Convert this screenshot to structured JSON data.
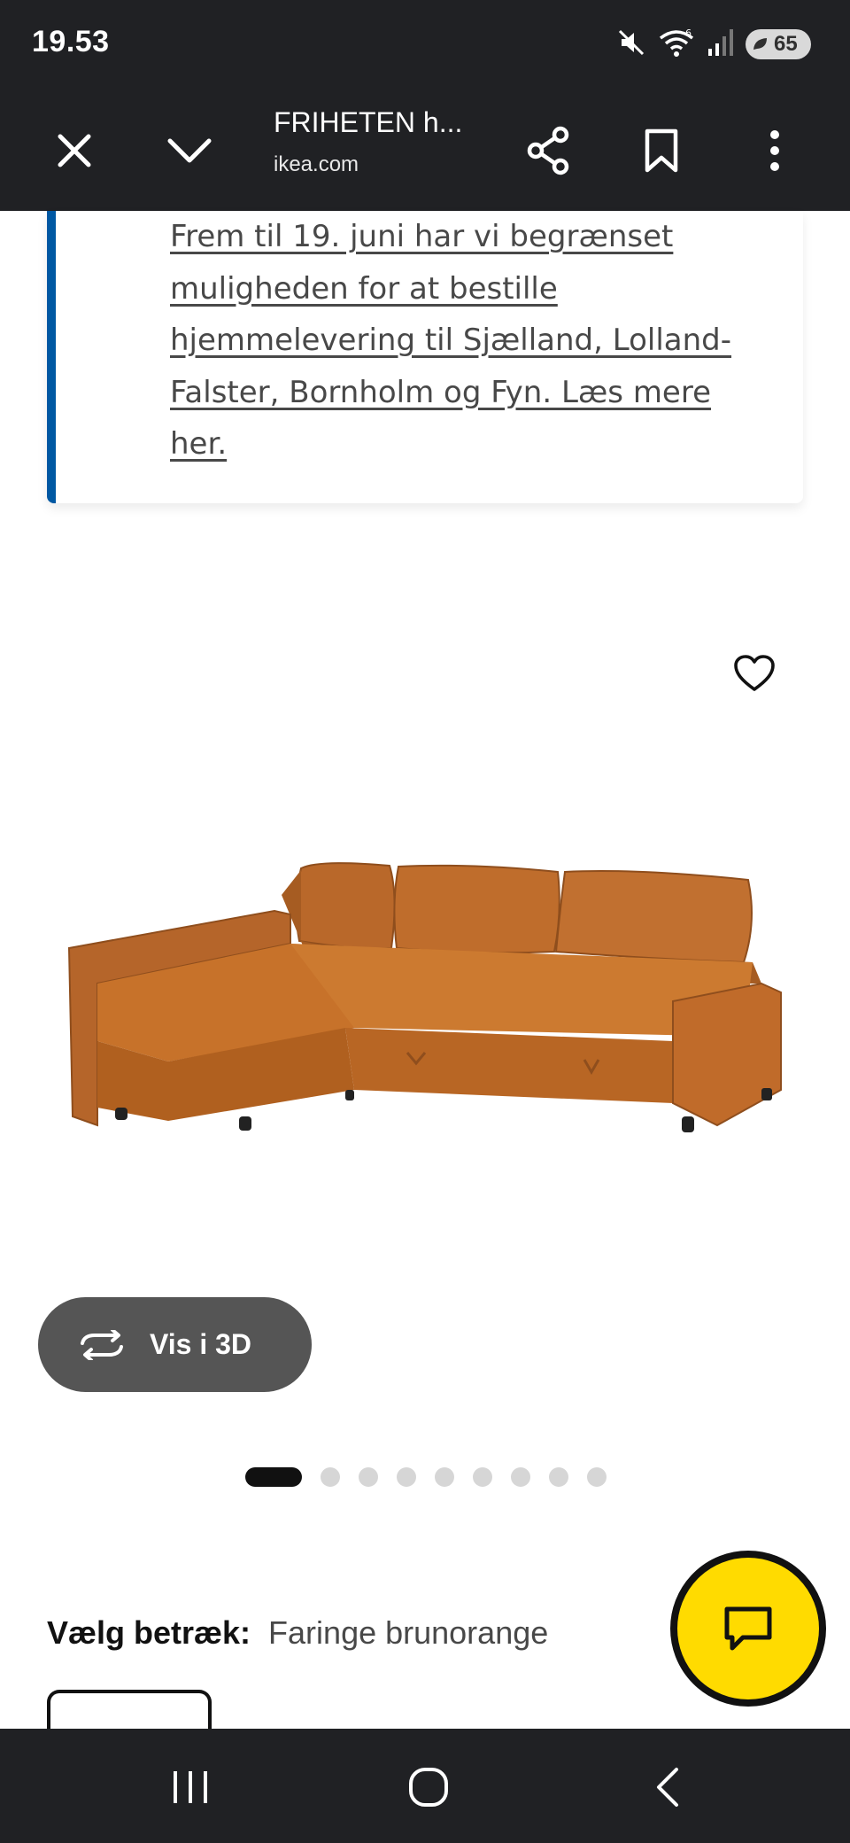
{
  "status_bar": {
    "time": "19.53",
    "battery": "65"
  },
  "toolbar": {
    "title": "FRIHETEN h...",
    "domain": "ikea.com"
  },
  "notice": {
    "text": "Frem til 19. juni har vi begrænset muligheden for at bestille hjemmelevering til Sjælland, Lolland-Falster, Bornholm og Fyn. Læs mere her."
  },
  "gallery": {
    "view3d_label": "Vis i 3D",
    "dot_count": 9,
    "active_index": 0
  },
  "cover": {
    "label": "Vælg betræk:",
    "value": "Faringe brunorange"
  },
  "colors": {
    "bar_bg": "#202124",
    "accent_blue": "#0058a3",
    "fab_yellow": "#ffdb00",
    "sofa": "#c7722a"
  }
}
